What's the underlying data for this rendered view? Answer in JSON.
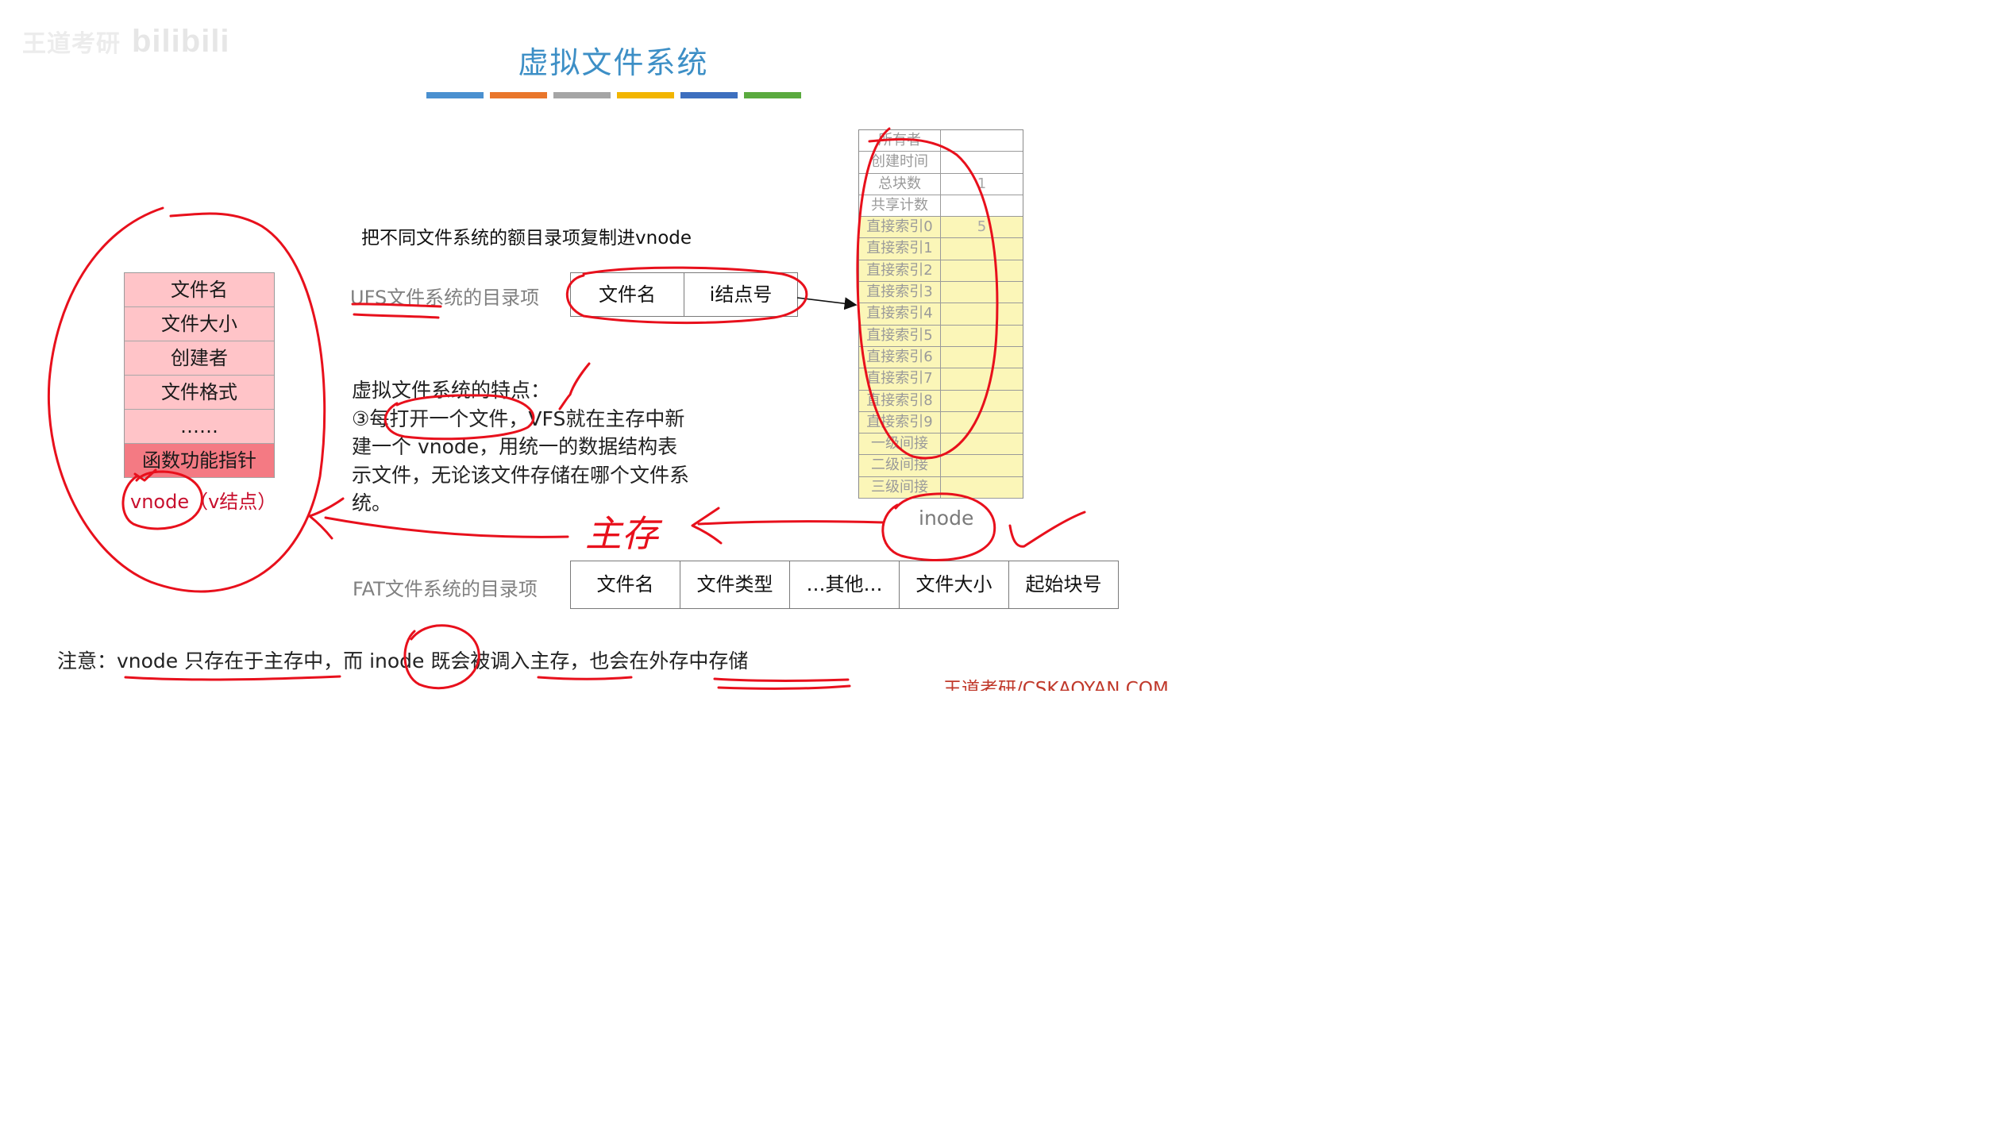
{
  "watermark": {
    "text": "王道考研",
    "site": "bilibili"
  },
  "title": "虚拟文件系统",
  "title_bar_colors": [
    "#4a90d0",
    "#e9762b",
    "#a5a5a5",
    "#f2b500",
    "#3d6fbf",
    "#5aaa3e"
  ],
  "vnode": {
    "rows": [
      "文件名",
      "文件大小",
      "创建者",
      "文件格式",
      "……",
      "函数功能指针"
    ],
    "caption": "vnode（v结点）"
  },
  "copy_note": "把不同文件系统的额目录项复制进vnode",
  "ufs": {
    "label": "UFS文件系统的目录项",
    "cells": [
      "文件名",
      "i结点号"
    ]
  },
  "features": {
    "heading": "虚拟文件系统的特点：",
    "body": "③每打开一个文件，VFS就在主存中新建一个 vnode，用统一的数据结构表示文件，无论该文件存储在哪个文件系统。"
  },
  "inode": {
    "rows": [
      {
        "label": "所有者",
        "value": ""
      },
      {
        "label": "创建时间",
        "value": ""
      },
      {
        "label": "总块数",
        "value": "1"
      },
      {
        "label": "共享计数",
        "value": ""
      },
      {
        "label": "直接索引0",
        "value": "5"
      },
      {
        "label": "直接索引1",
        "value": ""
      },
      {
        "label": "直接索引2",
        "value": ""
      },
      {
        "label": "直接索引3",
        "value": ""
      },
      {
        "label": "直接索引4",
        "value": ""
      },
      {
        "label": "直接索引5",
        "value": ""
      },
      {
        "label": "直接索引6",
        "value": ""
      },
      {
        "label": "直接索引7",
        "value": ""
      },
      {
        "label": "直接索引8",
        "value": ""
      },
      {
        "label": "直接索引9",
        "value": ""
      },
      {
        "label": "一级间接",
        "value": ""
      },
      {
        "label": "二级间接",
        "value": ""
      },
      {
        "label": "三级间接",
        "value": ""
      }
    ],
    "caption": "inode"
  },
  "fat": {
    "label": "FAT文件系统的目录项",
    "cells": [
      "文件名",
      "文件类型",
      "…其他…",
      "文件大小",
      "起始块号"
    ]
  },
  "handwriting": {
    "text": "主存",
    "ink_color": "#e8101c"
  },
  "bottom_note": "注意：vnode 只存在于主存中，而 inode 既会被调入主存，也会在外存中存储",
  "brand": "王道考研/CSKAOYAN.COM"
}
